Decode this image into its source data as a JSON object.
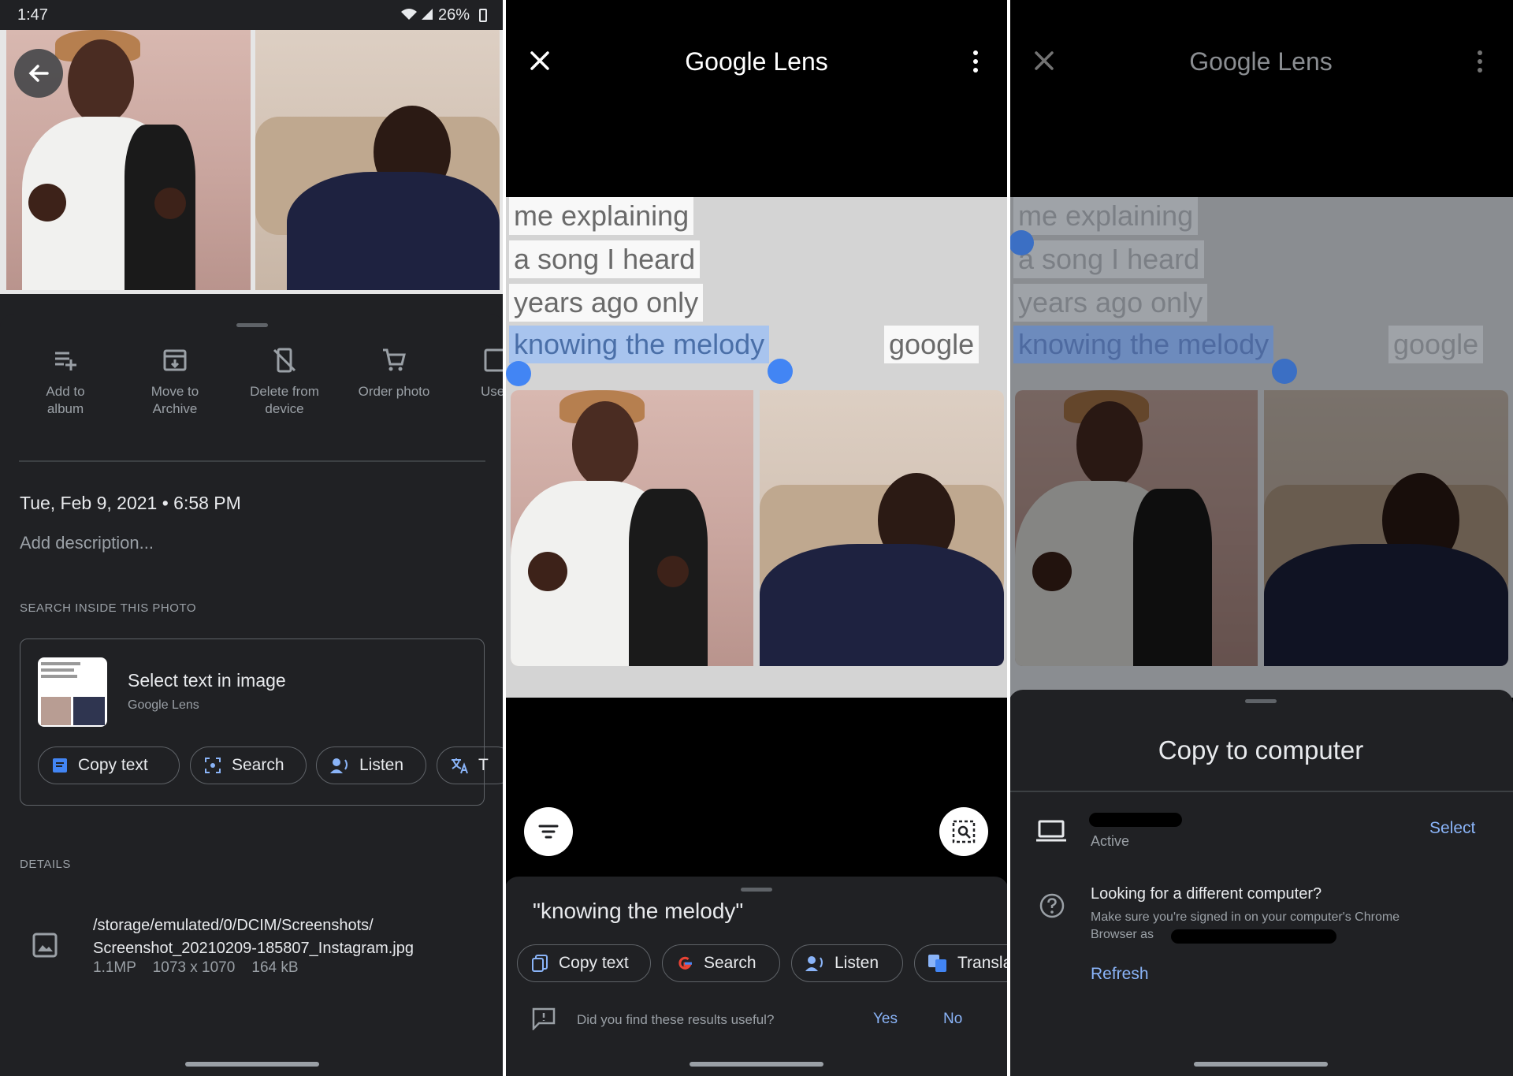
{
  "panel1": {
    "status": {
      "time": "1:47",
      "battery": "26%"
    },
    "actions": [
      {
        "label": "Add to\nalbum",
        "icon": "playlist-add-icon"
      },
      {
        "label": "Move to\nArchive",
        "icon": "archive-icon"
      },
      {
        "label": "Delete from\ndevice",
        "icon": "delete-device-icon"
      },
      {
        "label": "Order photo",
        "icon": "cart-icon"
      },
      {
        "label": "Use",
        "icon": "use-icon"
      }
    ],
    "datetime": "Tue, Feb 9, 2021  •  6:58 PM",
    "add_description": "Add description...",
    "search_inside": "SEARCH INSIDE THIS PHOTO",
    "lens_card": {
      "title": "Select text in image",
      "subtitle": "Google Lens",
      "chips": [
        "Copy text",
        "Search",
        "Listen",
        "T"
      ]
    },
    "details_label": "DETAILS",
    "file": {
      "path_line1": "/storage/emulated/0/DCIM/Screenshots/",
      "path_line2": "Screenshot_20210209-185807_Instagram.jpg",
      "meta": "1.1MP    1073 x 1070    164 kB"
    }
  },
  "panel2": {
    "title": "Google Lens",
    "meme_lines": [
      "me explaining",
      "a song I heard",
      "years ago only",
      "knowing the melody"
    ],
    "meme_tag": "google",
    "selected_text": "\"knowing the melody\"",
    "chips": [
      "Copy text",
      "Search",
      "Listen",
      "Transla"
    ],
    "feedback": {
      "question": "Did you find these results useful?",
      "yes": "Yes",
      "no": "No"
    }
  },
  "panel3": {
    "title": "Google Lens",
    "meme_lines": [
      "me explaining",
      "a song I heard",
      "years ago only",
      "knowing the melody"
    ],
    "meme_tag": "google",
    "sheet": {
      "title": "Copy to computer",
      "device_status": "Active",
      "select": "Select",
      "help_title": "Looking for a different computer?",
      "help_body": "Make sure you're signed in on your computer's Chrome\nBrowser as",
      "refresh": "Refresh"
    }
  },
  "colors": {
    "accent": "#8ab4f8",
    "selection": "#a8c4ee",
    "handle": "#4285f4"
  }
}
